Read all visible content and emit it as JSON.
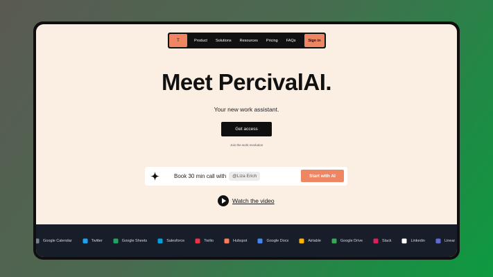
{
  "nav": {
    "logo": "T",
    "items": [
      "Product",
      "Solutions",
      "Resources",
      "Pricing",
      "FAQs"
    ],
    "signin": "Sign in"
  },
  "hero": {
    "title": "Meet PercivalAI.",
    "subtitle": "Your new work assistant.",
    "cta": "Get access",
    "cta_note": "Join the work revolution"
  },
  "booking": {
    "label": "Book 30 min call with",
    "tag": "@Liza Erich",
    "button": "Start with AI"
  },
  "video": {
    "label": "Watch the video"
  },
  "integrations": [
    {
      "name": "Google Calendar",
      "icon": "google-calendar-icon",
      "color": "#7a8090"
    },
    {
      "name": "Twitter",
      "icon": "twitter-icon",
      "color": "#1da1f2"
    },
    {
      "name": "Google Sheets",
      "icon": "google-sheets-icon",
      "color": "#1fa463"
    },
    {
      "name": "Salesforce",
      "icon": "salesforce-icon",
      "color": "#00a1e0"
    },
    {
      "name": "Twilio",
      "icon": "twilio-icon",
      "color": "#f22f46"
    },
    {
      "name": "Hubspot",
      "icon": "hubspot-icon",
      "color": "#ff7a59"
    },
    {
      "name": "Google Docs",
      "icon": "google-docs-icon",
      "color": "#4285f4"
    },
    {
      "name": "Airtable",
      "icon": "airtable-icon",
      "color": "#fcb400"
    },
    {
      "name": "Google Drive",
      "icon": "google-drive-icon",
      "color": "#34a853"
    },
    {
      "name": "Slack",
      "icon": "slack-icon",
      "color": "#e01e5a"
    },
    {
      "name": "Linkedin",
      "icon": "linkedin-icon",
      "color": "#ffffff"
    },
    {
      "name": "Linear",
      "icon": "linear-icon",
      "color": "#5e6ad2"
    },
    {
      "name": "",
      "icon": "gmail-icon",
      "color": "#ea4335"
    }
  ],
  "colors": {
    "accent": "#ef8663",
    "background": "#fbeee3",
    "dark": "#111111",
    "footer": "#171d29"
  }
}
